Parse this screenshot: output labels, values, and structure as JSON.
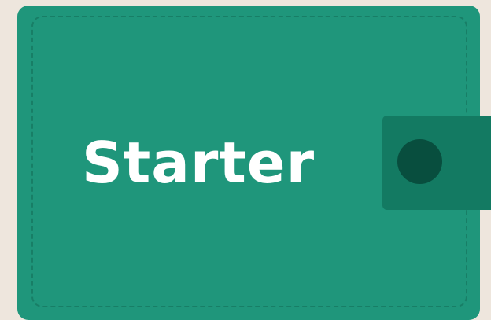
{
  "wallet": {
    "label": "Starter"
  }
}
